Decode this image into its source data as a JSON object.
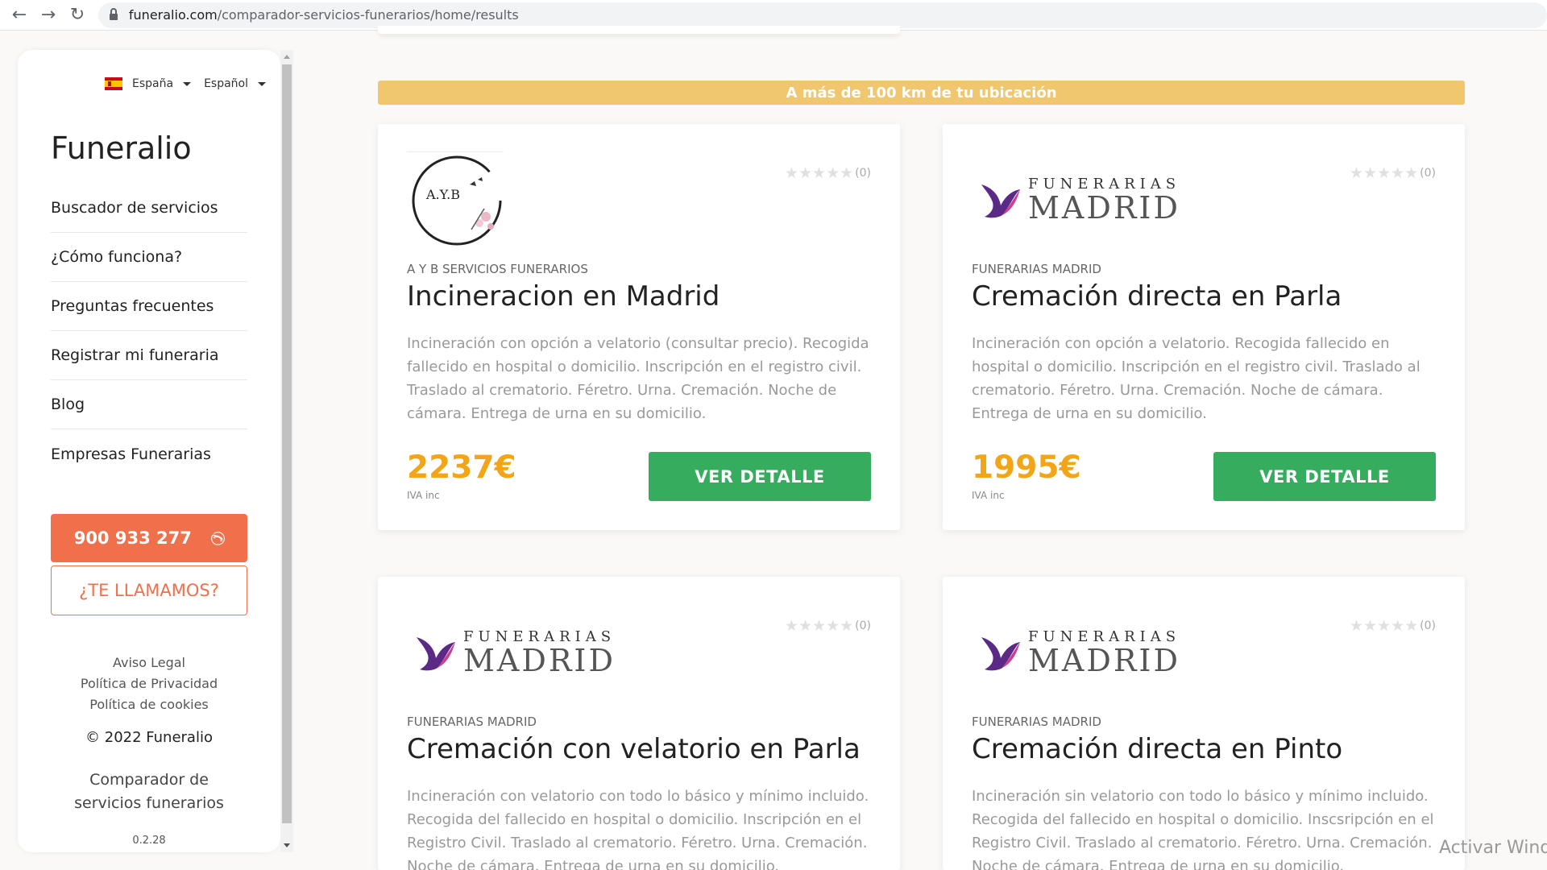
{
  "browser": {
    "url_domain": "funeralio.com",
    "url_path": "/comparador-servicios-funerarios/home/results"
  },
  "sidebar": {
    "country": "España",
    "language": "Español",
    "brand": "Funeralio",
    "menu": [
      {
        "label": "Buscador de servicios"
      },
      {
        "label": "¿Cómo funciona?"
      },
      {
        "label": "Preguntas frecuentes"
      },
      {
        "label": "Registrar mi funeraria"
      },
      {
        "label": "Blog"
      },
      {
        "label": "Empresas Funerarias"
      }
    ],
    "phone": "900 933 277",
    "callback": "¿TE LLAMAMOS?",
    "legal": [
      "Aviso Legal",
      "Política de Privacidad",
      "Política de cookies"
    ],
    "copyright": "© 2022 Funeralio",
    "comparador": "Comparador de servicios funerarios",
    "version": "0.2.28"
  },
  "banner": "A más de 100 km de tu ubicación",
  "cards": [
    {
      "logo": "AYB",
      "logo_text": "A.Y.B",
      "rating_count": "(0)",
      "company": "A Y B SERVICIOS FUNERARIOS",
      "title": "Incineracion en Madrid",
      "description": "Incineración con opción a velatorio (consultar precio). Recogida fallecido en hospital o domicilio. Inscripción en el registro civil. Traslado al crematorio. Féretro. Urna. Cremación. Noche de cámara. Entrega de urna en su domicilio.",
      "price": "2237€",
      "iva": "IVA inc",
      "button": "VER DETALLE"
    },
    {
      "logo": "FM",
      "rating_count": "(0)",
      "company": "FUNERARIAS MADRID",
      "title": "Cremación directa en Parla",
      "description": "Incineración con opción a velatorio. Recogida fallecido en hospital o domicilio. Inscripción en el registro civil. Traslado al crematorio. Féretro. Urna. Cremación. Noche de cámara. Entrega de urna en su domicilio.",
      "price": "1995€",
      "iva": "IVA inc",
      "button": "VER DETALLE"
    },
    {
      "logo": "FM",
      "rating_count": "(0)",
      "company": "FUNERARIAS MADRID",
      "title": "Cremación con velatorio en Parla",
      "description": "Incineración con velatorio con todo lo básico y mínimo incluido. Recogida del fallecido en hospital o domicilio. Inscripción en el Registro Civil. Traslado al crematorio. Féretro. Urna. Cremación. Noche de cámara. Entrega de urna en su domicilio."
    },
    {
      "logo": "FM",
      "rating_count": "(0)",
      "company": "FUNERARIAS MADRID",
      "title": "Cremación directa en Pinto",
      "description": "Incineración sin velatorio con todo lo básico y mínimo incluido. Recogida del fallecido en hospital o domicilio. Inscsripción en el Registro Civil. Traslado al crematorio. Féretro. Urna. Cremación. Noche de cámara. Entrega de urna en su domicilio."
    }
  ],
  "fm_logo": {
    "top": "FUNERARIAS",
    "bottom": "MADRID"
  },
  "watermark": "Activar Windows",
  "colors": {
    "accent_orange": "#f0704c",
    "price_orange": "#f2a516",
    "button_green": "#36ac5e",
    "banner_yellow": "#f0c66e"
  },
  "icons": [
    "back-arrow-icon",
    "forward-arrow-icon",
    "reload-icon",
    "lock-icon",
    "spain-flag-icon",
    "chevron-down-icon",
    "phone-icon",
    "star-icon"
  ]
}
